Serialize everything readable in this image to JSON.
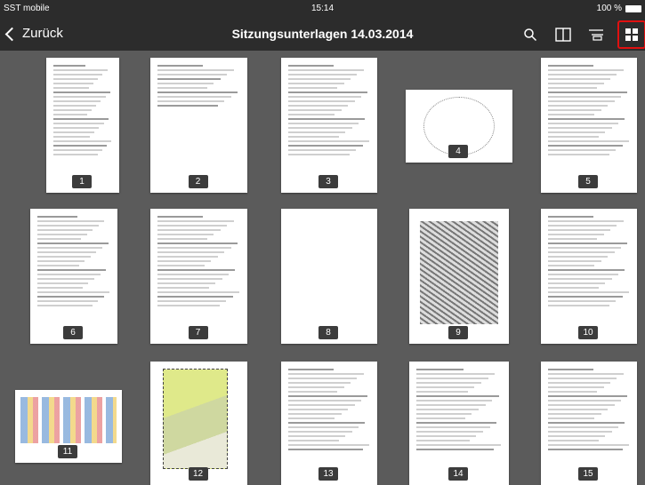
{
  "status": {
    "carrier": "SST mobile",
    "time": "15:14",
    "battery": "100 %"
  },
  "nav": {
    "back_label": "Zurück",
    "title": "Sitzungsunterlagen 14.03.2014",
    "icons": [
      "search-icon",
      "book-icon",
      "list-icon",
      "grid-icon"
    ]
  },
  "pages": [
    {
      "label": "1",
      "kind": "agenda"
    },
    {
      "label": "2",
      "kind": "list"
    },
    {
      "label": "3",
      "kind": "letter"
    },
    {
      "label": "4",
      "kind": "diagram"
    },
    {
      "label": "5",
      "kind": "letter"
    },
    {
      "label": "6",
      "kind": "letter"
    },
    {
      "label": "7",
      "kind": "letter"
    },
    {
      "label": "8",
      "kind": "blank"
    },
    {
      "label": "9",
      "kind": "map"
    },
    {
      "label": "10",
      "kind": "letter"
    },
    {
      "label": "11",
      "kind": "table"
    },
    {
      "label": "12",
      "kind": "plan"
    },
    {
      "label": "13",
      "kind": "letter"
    },
    {
      "label": "14",
      "kind": "letter"
    },
    {
      "label": "15",
      "kind": "letter"
    }
  ],
  "colors": {
    "bar": "#2c2c2c",
    "background": "#5b5b5b",
    "highlight": "#e01010"
  }
}
